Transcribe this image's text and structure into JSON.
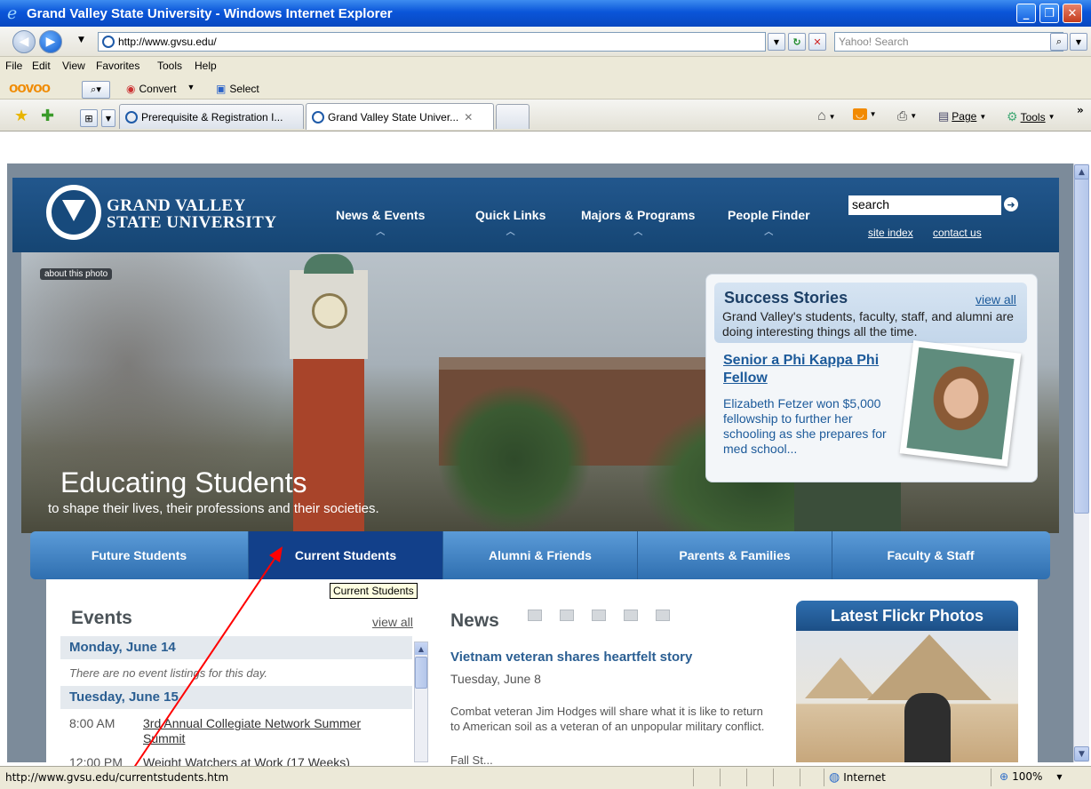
{
  "window": {
    "title": "Grand Valley State University - Windows Internet Explorer",
    "minimize_icon": "minimize-icon",
    "maximize_icon": "restore-icon",
    "close_icon": "close-icon"
  },
  "address_bar": {
    "url": "http://www.gvsu.edu/",
    "search_placeholder": "Yahoo! Search"
  },
  "menu": [
    "File",
    "Edit",
    "View",
    "Favorites",
    "Tools",
    "Help"
  ],
  "oodoo_bar": {
    "logo": "oovoo",
    "convert_label": "Convert",
    "select_label": "Select"
  },
  "tabs": [
    {
      "label": "Prerequisite & Registration I...",
      "active": false
    },
    {
      "label": "Grand Valley State Univer...",
      "active": true
    }
  ],
  "command_bar": {
    "page_label": "Page",
    "tools_label": "Tools"
  },
  "site": {
    "logo_line1": "GRAND VALLEY",
    "logo_line2": "STATE UNIVERSITY",
    "nav": [
      "News & Events",
      "Quick Links",
      "Majors & Programs",
      "People Finder"
    ],
    "search_value": "search",
    "site_index": "site index",
    "contact_us": "contact us",
    "about_photo": "about this photo",
    "hero_title": "Educating Students",
    "hero_subtitle": "to shape their lives, their professions and their societies.",
    "success": {
      "title": "Success Stories",
      "view_all": "view all",
      "description": "Grand Valley's students, faculty, staff, and alumni are doing interesting things all the time.",
      "story_title": "Senior a Phi Kappa Phi Fellow",
      "story_text": "Elizabeth Fetzer won $5,000 fellowship to further her schooling as she prepares for med school..."
    },
    "audience_tabs": [
      {
        "label": "Future Students",
        "active": false
      },
      {
        "label": "Current Students",
        "active": true
      },
      {
        "label": "Alumni & Friends",
        "active": false
      },
      {
        "label": "Parents & Families",
        "active": false
      },
      {
        "label": "Faculty & Staff",
        "active": false
      }
    ],
    "tooltip": "Current Students",
    "events": {
      "title": "Events",
      "view_all": "view all",
      "day1": "Monday, June 14",
      "day1_none": "There are no event listings for this day.",
      "day2": "Tuesday, June 15",
      "items": [
        {
          "time": "8:00 AM",
          "name": "3rd Annual Collegiate Network Summer Summit"
        },
        {
          "time": "12:00 PM",
          "name": "Weight Watchers at Work (17 Weeks)"
        }
      ]
    },
    "news": {
      "title": "News",
      "headline": "Vietnam veteran shares heartfelt story",
      "date": "Tuesday, June 8",
      "body": "Combat veteran Jim Hodges will share what it is like to return to American soil as a veteran of an unpopular military conflict.",
      "next_line": "Fall St..."
    },
    "flickr": {
      "title": "Latest Flickr Photos"
    }
  },
  "status_bar": {
    "text": "http://www.gvsu.edu/currentstudents.htm",
    "zone": "Internet",
    "zoom": "100%"
  },
  "colors": {
    "gvsu_blue": "#154573",
    "tab_blue": "#2f6fb0",
    "link_blue": "#1c5a9a",
    "annotation_arrow": "#ff0000"
  }
}
